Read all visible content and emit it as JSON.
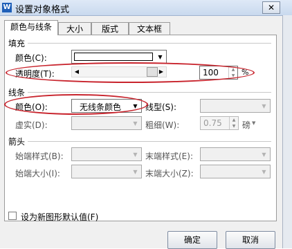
{
  "window": {
    "title": "设置对象格式",
    "app_icon": "W",
    "close_glyph": "✕"
  },
  "tabs": [
    {
      "label": "颜色与线条"
    },
    {
      "label": "大小"
    },
    {
      "label": "版式"
    },
    {
      "label": "文本框"
    }
  ],
  "fill": {
    "section": "填充",
    "color_label": "颜色(C):",
    "color_value": "#ffffff",
    "transparency_label": "透明度(T):",
    "transparency_value": "100",
    "transparency_unit": "%",
    "transparency_level": 100
  },
  "line": {
    "section": "线条",
    "color_label": "颜色(O):",
    "color_value": "无线条颜色",
    "style_label": "线型(S):",
    "dash_label": "虚实(D):",
    "weight_label": "粗细(W):",
    "weight_value": "0.75",
    "weight_unit": "磅"
  },
  "arrows": {
    "section": "箭头",
    "begin_style_label": "始端样式(B):",
    "end_style_label": "末端样式(E):",
    "begin_size_label": "始端大小(I):",
    "end_size_label": "末端大小(Z):"
  },
  "default_checkbox": {
    "label": "设为新图形默认值(F)",
    "checked": false
  },
  "buttons": {
    "ok": "确定",
    "cancel": "取消"
  },
  "annotation_color": "#c8232c"
}
